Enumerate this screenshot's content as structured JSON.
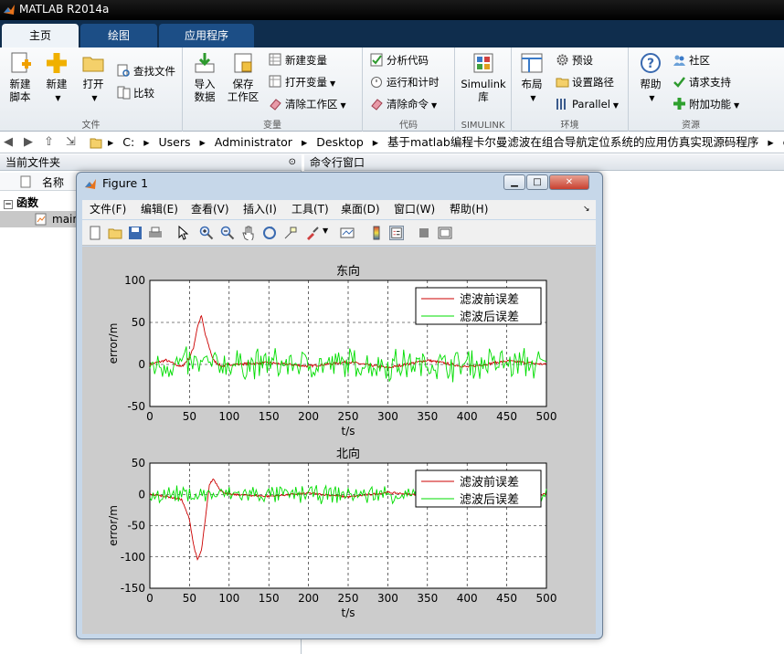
{
  "app": {
    "title": "MATLAB R2014a"
  },
  "tabs": [
    {
      "label": "主页"
    },
    {
      "label": "绘图"
    },
    {
      "label": "应用程序"
    }
  ],
  "ribbon": {
    "file": {
      "group": "文件",
      "new_script": "新建\n脚本",
      "new": "新建",
      "open": "打开",
      "find_files": "查找文件",
      "compare": "比较"
    },
    "variable": {
      "group": "变量",
      "import": "导入\n数据",
      "save_ws": "保存\n工作区",
      "new_var": "新建变量",
      "open_var": "打开变量",
      "clear_ws": "清除工作区"
    },
    "code": {
      "group": "代码",
      "analyze": "分析代码",
      "run_time": "运行和计时",
      "clear_cmd": "清除命令"
    },
    "simulink": {
      "group": "SIMULINK",
      "lib": "Simulink\n库"
    },
    "env": {
      "group": "环境",
      "layout": "布局",
      "prefs": "预设",
      "set_path": "设置路径",
      "parallel": "Parallel"
    },
    "resources": {
      "group": "资源",
      "help": "帮助",
      "community": "社区",
      "support": "请求支持",
      "addons": "附加功能"
    }
  },
  "address": {
    "crumbs": [
      "C:",
      "Users",
      "Administrator",
      "Desktop",
      "基于matlab编程卡尔曼滤波在组合导航定位系统的应用仿真实现源码程序",
      "code"
    ]
  },
  "file_browser": {
    "title": "当前文件夹",
    "col_name": "名称",
    "section": "函数",
    "item": "main"
  },
  "command_window": {
    "title": "命令行窗口"
  },
  "figure": {
    "title": "Figure 1",
    "menu": [
      "文件(F)",
      "编辑(E)",
      "查看(V)",
      "插入(I)",
      "工具(T)",
      "桌面(D)",
      "窗口(W)",
      "帮助(H)"
    ]
  },
  "colors": {
    "before": "#cc0000",
    "after": "#00dd00"
  },
  "chart_data": [
    {
      "type": "line",
      "title": "东向",
      "xlabel": "t/s",
      "ylabel": "error/m",
      "xlim": [
        0,
        500
      ],
      "ylim": [
        -50,
        100
      ],
      "xticks": [
        "0",
        "50",
        "100",
        "150",
        "200",
        "250",
        "300",
        "350",
        "400",
        "450",
        "500"
      ],
      "yticks": [
        "100",
        "50",
        "0",
        "-50"
      ],
      "grid": true,
      "legend_position": "top-right",
      "series": [
        {
          "name": "滤波前误差",
          "color": "#cc0000",
          "x": [
            0,
            20,
            40,
            50,
            55,
            60,
            65,
            70,
            80,
            90,
            100,
            150,
            200,
            250,
            300,
            350,
            400,
            450,
            500
          ],
          "y": [
            0,
            5,
            -3,
            8,
            20,
            45,
            58,
            35,
            5,
            -2,
            0,
            2,
            -2,
            3,
            -4,
            5,
            -3,
            4,
            0
          ]
        },
        {
          "name": "滤波后误差",
          "color": "#00dd00",
          "x": [
            0,
            50,
            100,
            150,
            200,
            250,
            300,
            350,
            400,
            450,
            500
          ],
          "y": [
            0,
            0,
            0,
            0,
            0,
            0,
            0,
            0,
            0,
            0,
            0
          ],
          "amplitude": 25
        }
      ]
    },
    {
      "type": "line",
      "title": "北向",
      "xlabel": "t/s",
      "ylabel": "error/m",
      "xlim": [
        0,
        500
      ],
      "ylim": [
        -150,
        50
      ],
      "xticks": [
        "0",
        "50",
        "100",
        "150",
        "200",
        "250",
        "300",
        "350",
        "400",
        "450",
        "500"
      ],
      "yticks": [
        "50",
        "0",
        "-50",
        "-100",
        "-150"
      ],
      "grid": true,
      "legend_position": "top-right",
      "series": [
        {
          "name": "滤波前误差",
          "color": "#cc0000",
          "x": [
            0,
            20,
            40,
            50,
            55,
            60,
            65,
            70,
            75,
            80,
            90,
            100,
            150,
            200,
            250,
            300,
            350,
            400,
            450,
            500
          ],
          "y": [
            0,
            -3,
            -8,
            -40,
            -80,
            -105,
            -90,
            -40,
            15,
            25,
            5,
            0,
            -3,
            2,
            -4,
            3,
            -2,
            3,
            -3,
            0
          ]
        },
        {
          "name": "滤波后误差",
          "color": "#00dd00",
          "x": [
            0,
            50,
            100,
            150,
            200,
            250,
            300,
            350,
            400,
            450,
            500
          ],
          "y": [
            0,
            0,
            0,
            0,
            0,
            0,
            0,
            0,
            0,
            0,
            0
          ],
          "amplitude": 20
        }
      ]
    }
  ]
}
